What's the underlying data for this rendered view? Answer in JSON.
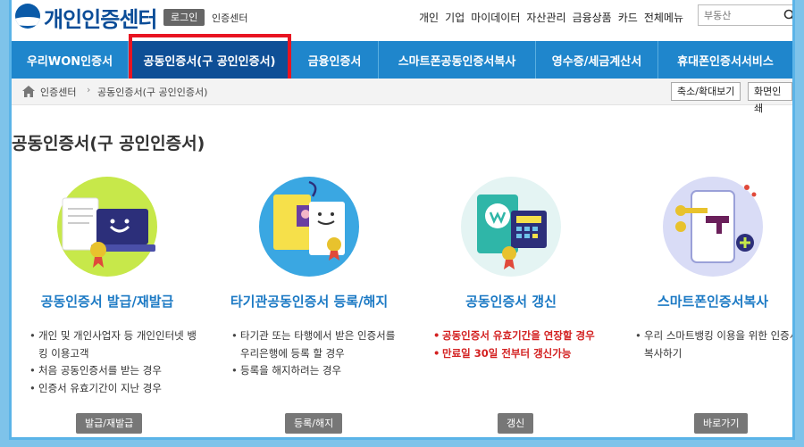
{
  "header": {
    "logo_text": "개인인증센터",
    "login_label": "로그인",
    "center_label": "인증센터",
    "top_links": [
      "개인",
      "기업",
      "마이데이터",
      "자산관리",
      "금융상품",
      "카드",
      "전체메뉴"
    ],
    "search_placeholder": "부동산"
  },
  "nav": {
    "items": [
      {
        "label": "우리WON인증서"
      },
      {
        "label": "공동인증서(구 공인인증서)"
      },
      {
        "label": "금융인증서"
      },
      {
        "label": "스마트폰공동인증서복사"
      },
      {
        "label": "영수증/세금계산서"
      },
      {
        "label": "휴대폰인증서서비스"
      }
    ]
  },
  "breadcrumb": {
    "items": [
      "인증센터",
      "공동인증서(구 공인인증서)"
    ],
    "zoom_label": "축소/확대보기",
    "print_label": "화면인쇄"
  },
  "page_title": "공동인증서(구 공인인증서)",
  "cards": [
    {
      "title": "공동인증서 발급/재발급",
      "items": [
        "개인 및 개인사업자 등 개인인터넷 뱅킹 이용고객",
        "처음 공동인증서를 받는 경우",
        "인증서 유효기간이 지난 경우"
      ],
      "button": "발급/재발급"
    },
    {
      "title": "타기관공동인증서 등록/해지",
      "items": [
        "타기관 또는 타행에서 받은 인증서를 우리은행에 등록 할 경우",
        "등록을 해지하려는 경우"
      ],
      "button": "등록/해지"
    },
    {
      "title": "공동인증서 갱신",
      "items": [
        "공동인증서 유효기간을 연장할 경우",
        "만료일 30일 전부터 갱신가능"
      ],
      "button": "갱신"
    },
    {
      "title": "스마트폰인증서복사",
      "items": [
        "우리 스마트뱅킹 이용을 위한 인증서 복사하기"
      ],
      "button": "바로가기"
    }
  ],
  "colors": {
    "nav_bg": "#1f86cc",
    "nav_active": "#0e4f96",
    "highlight": "#e81421",
    "title_blue": "#1b79c4",
    "warn_red": "#d32020"
  }
}
